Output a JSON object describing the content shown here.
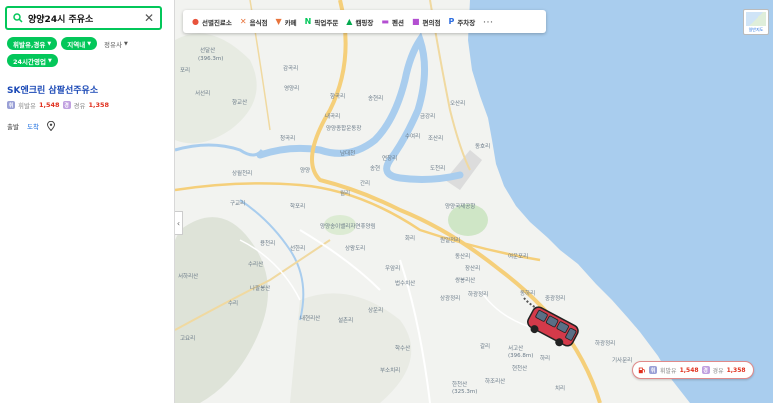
{
  "search": {
    "query": "양양24시 주유소"
  },
  "filters": [
    {
      "label": "휘발유,경유",
      "style": "green"
    },
    {
      "label": "지역내",
      "style": "green"
    },
    {
      "label": "정유사",
      "style": "plain"
    },
    {
      "label": "24시간영업",
      "style": "green"
    }
  ],
  "result": {
    "title": "SK엔크린 삼팔선주유소",
    "gas_badge": "휘",
    "gas_label": "휘발유",
    "gas_price": "1,548",
    "diesel_badge": "경",
    "diesel_label": "경유",
    "diesel_price": "1,358",
    "depart_label": "출발",
    "arrive_label": "도착"
  },
  "categories": [
    {
      "label": "선별진료소",
      "icon": "medical-pin-icon",
      "color": "#e8533c"
    },
    {
      "label": "음식점",
      "icon": "fork-knife-icon",
      "color": "#e8743c"
    },
    {
      "label": "카페",
      "icon": "cafe-cup-icon",
      "color": "#e8743c"
    },
    {
      "label": "픽업주문",
      "icon": "naver-n-icon",
      "color": "#03c75a"
    },
    {
      "label": "캠핑장",
      "icon": "tent-icon",
      "color": "#03a94e"
    },
    {
      "label": "펜션",
      "icon": "bed-icon",
      "color": "#b34fd1"
    },
    {
      "label": "편의점",
      "icon": "store-icon",
      "color": "#b34fd1"
    },
    {
      "label": "주차장",
      "icon": "parking-icon",
      "color": "#2f6fe0"
    },
    {
      "label": "···",
      "icon": "more-icon",
      "color": "#666666"
    }
  ],
  "map_type_label": "일반지도",
  "bubble": {
    "gas_badge": "휘",
    "gas_label": "휘발유",
    "gas_price": "1,548",
    "diesel_badge": "경",
    "diesel_label": "경유",
    "diesel_price": "1,358"
  },
  "map_labels": {
    "peak_1": "선달산",
    "peak_1_alt": "(396.3m)",
    "peak_2": "향교산",
    "peak_3": "월리산",
    "peak_4": "동호리산",
    "peak_5": "법수치산",
    "peak_6": "산성산",
    "peak_7": "해골산",
    "peak_8": "우각산",
    "peak_9": "쌍봉리산",
    "peak_10": "수리산",
    "peak_11": "내현리산",
    "peak_12": "나팔봉산",
    "peak_13": "잔교리산",
    "peak_14": "학수산",
    "peak_15": "하조리산",
    "peak_16": "도하산",
    "peak_17": "전진리산",
    "peak_18": "서하리산",
    "peak_19": "망칠산",
    "peak_20": "후곡리산",
    "peak_21": "현천산",
    "peak_22": "절리산",
    "peak_23": "한천산",
    "peak_23_alt": "(325.3m)",
    "peak_24": "오부산",
    "peak_25": "서고산",
    "peak_25_alt": "(396.8m)",
    "park_1": "양양종합운동장",
    "park_2": "양양송이밸리자연휴양림",
    "v1": "포리",
    "v2": "감곡리",
    "v3": "화일리",
    "v4": "서선리",
    "v5": "영양리",
    "v6": "향곡리",
    "v7": "사천리",
    "v8": "마곡리",
    "v9": "송현리",
    "v10": "내곡리",
    "v11": "금강리",
    "v12": "오산리",
    "v13": "동호리",
    "v14": "조산리",
    "v15": "수여리",
    "v16": "구교리",
    "v17": "남대천",
    "v18": "연창리",
    "v19": "청곡리",
    "v20": "양양",
    "v21": "상월천리",
    "v22": "월리",
    "v23": "구교리",
    "v24": "학포리",
    "v25": "용천리",
    "v26": "선한리",
    "v27": "간리",
    "v28": "상왕도리",
    "v29": "화리",
    "v30": "원일전리",
    "v31": "동산리",
    "v32": "우암리",
    "v33": "장산리",
    "v34": "여운포리",
    "v35": "동하리",
    "v36": "중광정리",
    "v37": "하광정리",
    "v38": "수리",
    "v39": "상운리",
    "v40": "설촌리",
    "v41": "고요리",
    "v42": "부소치리",
    "v43": "기사문리",
    "v44": "하광정리",
    "v45": "상광정리",
    "v46": "하리",
    "v47": "치리",
    "v48": "양양국제공항",
    "v49": "송현",
    "v50": "도천리",
    "v51": "아이리",
    "v52": "갈리",
    "v53": "손양",
    "v54": "오산리",
    "v55": "쌍천리",
    "v56": "상광정리"
  }
}
